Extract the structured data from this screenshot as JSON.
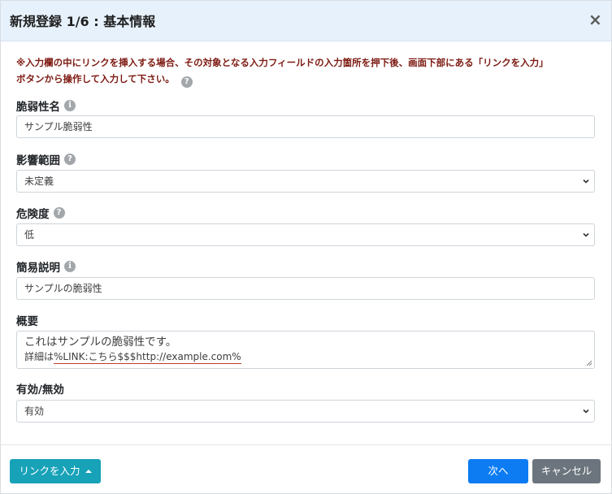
{
  "modal": {
    "title": "新規登録 1/6 : 基本情報",
    "close_symbol": "×"
  },
  "notice": {
    "line1": "※入力欄の中にリンクを挿入する場合、その対象となる入力フィールドの入力箇所を押下後、画面下部にある「リンクを入力」",
    "line2": "ボタンから操作して入力して下さい。"
  },
  "fields": {
    "vuln_name": {
      "label": "脆弱性名",
      "value": "サンプル脆弱性",
      "icon": "info-icon"
    },
    "impact_scope": {
      "label": "影響範囲",
      "value": "未定義",
      "icon": "help-icon"
    },
    "risk_level": {
      "label": "危険度",
      "value": "低",
      "icon": "help-icon"
    },
    "short_desc": {
      "label": "簡易説明",
      "value": "サンプルの脆弱性",
      "icon": "info-icon"
    },
    "overview": {
      "label": "概要",
      "line1": "これはサンプルの脆弱性です。",
      "line2_prefix": "詳細は",
      "line2_link": "%LINK:こちら$$$http://example.com%"
    },
    "enabled": {
      "label": "有効/無効",
      "value": "有効"
    }
  },
  "footer": {
    "link_button": "リンクを入力",
    "next_button": "次へ",
    "cancel_button": "キャンセル"
  },
  "colors": {
    "header_bg": "#e7f1fb",
    "notice_text": "#7d1a12",
    "link_button": "#17a2b8",
    "next_button": "#0d7cf2",
    "cancel_button": "#6c757d"
  }
}
